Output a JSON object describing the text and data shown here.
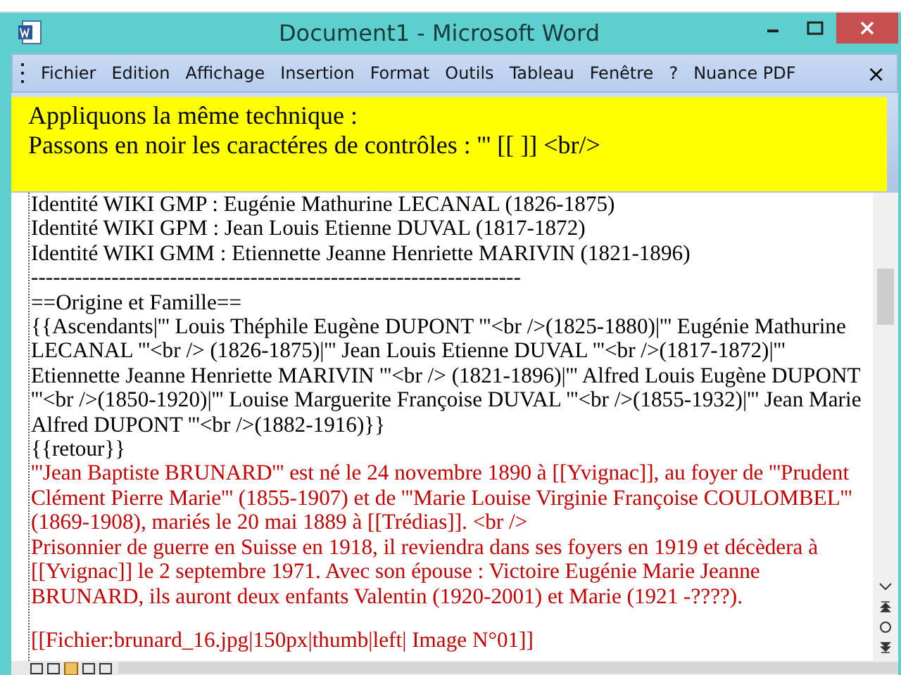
{
  "window": {
    "title": "Document1 - Microsoft Word"
  },
  "menu": {
    "items": [
      {
        "label": "Fichier"
      },
      {
        "label": "Edition"
      },
      {
        "label": "Affichage"
      },
      {
        "label": "Insertion"
      },
      {
        "label": "Format"
      },
      {
        "label": "Outils"
      },
      {
        "label": "Tableau"
      },
      {
        "label": "Fenêtre"
      },
      {
        "label": "?"
      },
      {
        "label": "Nuance PDF"
      }
    ],
    "close": "×"
  },
  "callout": {
    "lines": [
      "Appliquons la même technique :",
      "Passons en noir les caractéres de contrôles : ''' [[ ]] <br/>"
    ]
  },
  "document": {
    "paragraphs": [
      {
        "text": "Identité WIKI GMP : Eugénie Mathurine LECANAL (1826-1875)",
        "color": "#000000"
      },
      {
        "text": "Identité WIKI GPM : Jean Louis Etienne DUVAL (1817-1872)",
        "color": "#000000"
      },
      {
        "text": "Identité WIKI GMM : Etiennette Jeanne Henriette MARIVIN (1821-1896)",
        "color": "#000000"
      },
      {
        "text": "-------------------------------------------------------------------",
        "color": "#000000"
      },
      {
        "text": "==Origine et Famille==",
        "color": "#000000"
      },
      {
        "text": "{{Ascendants|''' Louis Théphile Eugène DUPONT '''<br />(1825-1880)|''' Eugénie Mathurine LECANAL '''<br /> (1826-1875)|''' Jean Louis Etienne DUVAL '''<br />(1817-1872)|''' Etiennette Jeanne Henriette MARIVIN '''<br /> (1821-1896)|''' Alfred Louis Eugène DUPONT '''<br />(1850-1920)|''' Louise Marguerite Françoise DUVAL '''<br />(1855-1932)|''' Jean Marie Alfred DUPONT '''<br />(1882-1916)}}",
        "color": "#000000"
      },
      {
        "text": "{{retour}}",
        "color": "#000000"
      },
      {
        "text": "'''Jean Baptiste BRUNARD''' est né le 24 novembre 1890 à [[Yvignac]], au foyer de '''Prudent Clément Pierre Marie''' (1855-1907) et de '''Marie Louise Virginie Françoise COULOMBEL''' (1869-1908), mariés le 20 mai 1889 à [[Trédias]]. <br />",
        "color": "#cc0000"
      },
      {
        "text": "Prisonnier de guerre en Suisse en 1918, il reviendra dans ses foyers en 1919 et décèdera à [[Yvignac]] le 2 septembre 1971. Avec son épouse : Victoire Eugénie Marie Jeanne BRUNARD, ils auront deux enfants Valentin (1920-2001) et Marie (1921 -????).",
        "color": "#cc0000"
      },
      {
        "text": "[[Fichier:brunard_16.jpg|150px|thumb|left| Image N°01]]",
        "color": "#cc0000"
      }
    ]
  }
}
